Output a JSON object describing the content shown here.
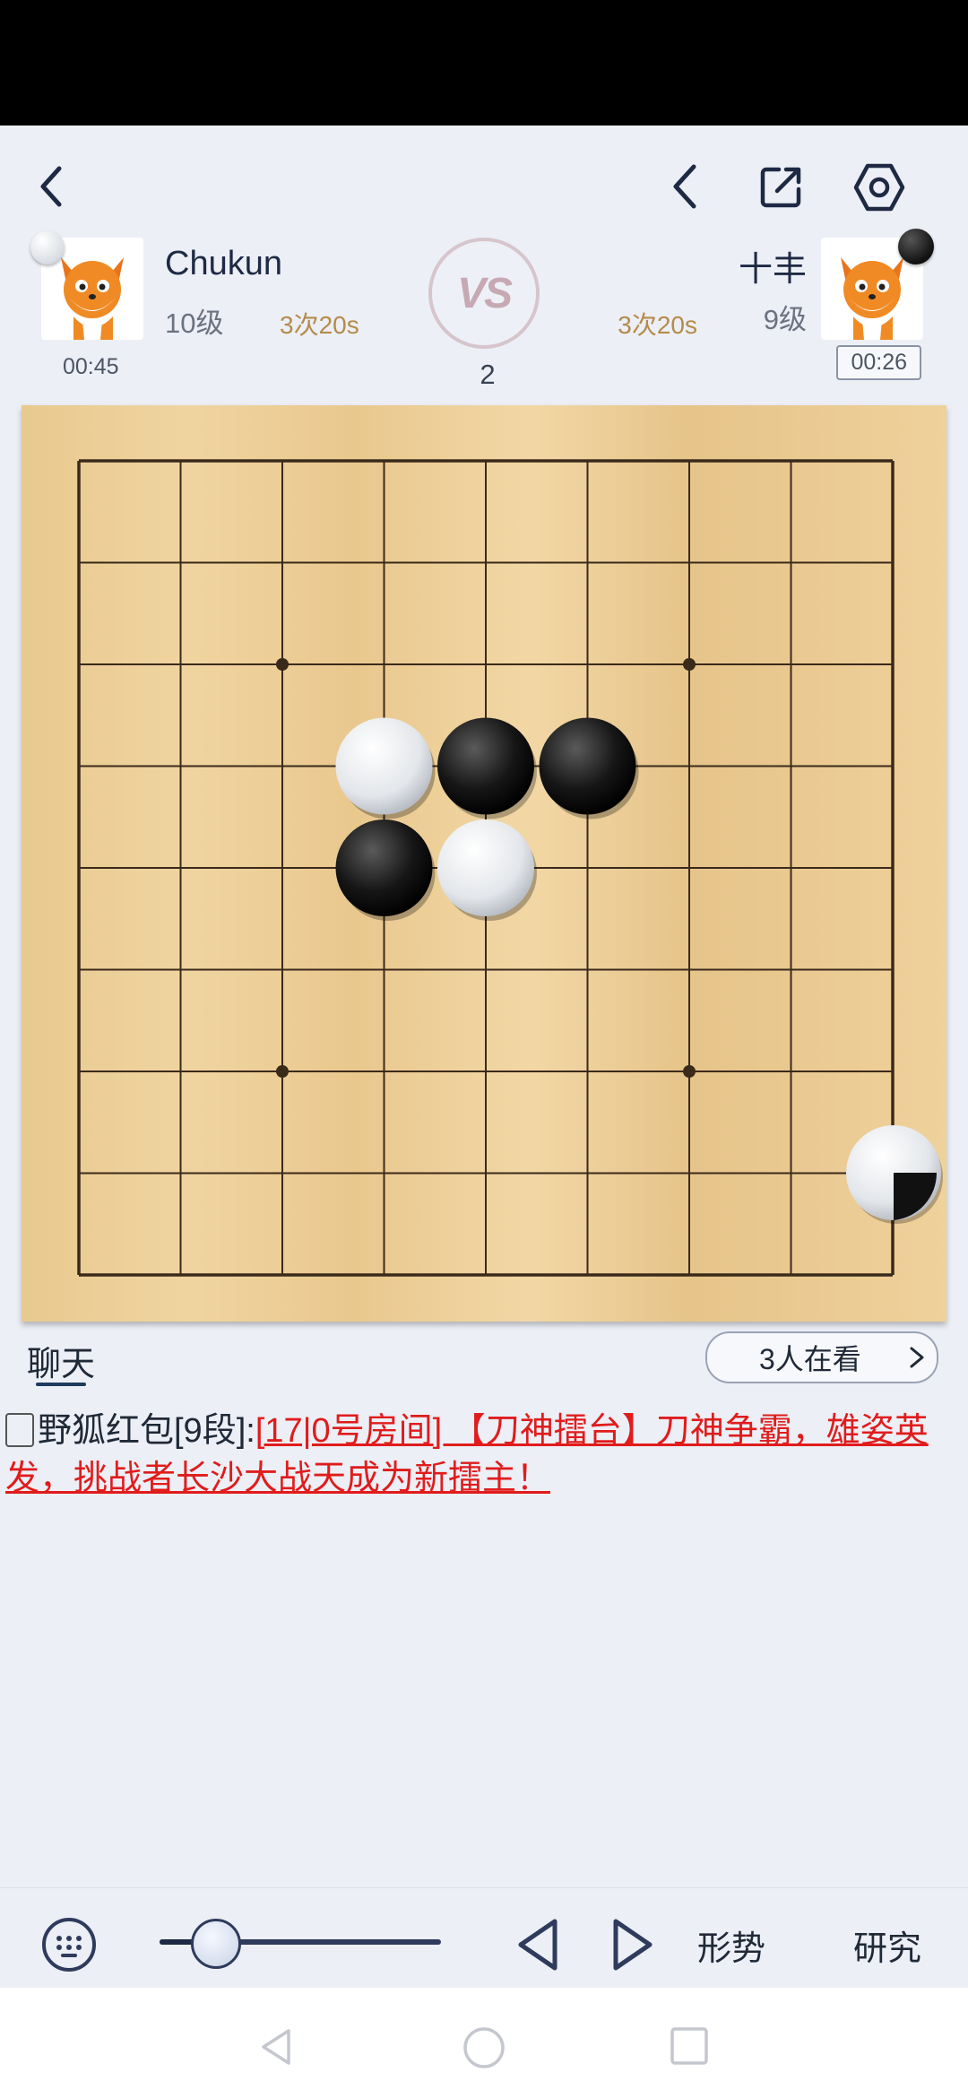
{
  "header": {
    "back_icon": "chevron-left-icon",
    "undo_icon": "chevron-left-icon",
    "share_icon": "share-icon",
    "settings_icon": "hexagon-settings-icon"
  },
  "players": {
    "left": {
      "name": "Chukun",
      "level": "10级",
      "byoyomi": "3次20s",
      "clock": "00:45",
      "stone": "white"
    },
    "right": {
      "name": "十丰",
      "level": "9级",
      "byoyomi": "3次20s",
      "clock": "00:26",
      "stone": "black"
    }
  },
  "vs_label": "VS",
  "move_number": "2",
  "board": {
    "size": 9,
    "star_points": [
      [
        2,
        2
      ],
      [
        6,
        2
      ],
      [
        2,
        6
      ],
      [
        6,
        6
      ]
    ],
    "stones": [
      {
        "col": 3,
        "row": 3,
        "color": "white"
      },
      {
        "col": 4,
        "row": 3,
        "color": "black"
      },
      {
        "col": 5,
        "row": 3,
        "color": "black"
      },
      {
        "col": 3,
        "row": 4,
        "color": "black"
      },
      {
        "col": 4,
        "row": 4,
        "color": "white"
      }
    ]
  },
  "chat": {
    "tab_label": "聊天",
    "watchers_label": "3人在看",
    "message": {
      "sender": "野狐红包[9段]:",
      "text": "[17|0号房间] 【刀神擂台】刀神争霸，雄姿英发，挑战者长沙大战天成为新擂主！"
    }
  },
  "toolbar": {
    "keyboard_icon": "keyboard-icon",
    "prev_icon": "triangle-left-icon",
    "next_icon": "triangle-right-icon",
    "situation_label": "形势",
    "research_label": "研究",
    "slider_level": 0.19
  },
  "colors": {
    "chat_link": "#e01c1c",
    "accent": "#1e2a44"
  }
}
